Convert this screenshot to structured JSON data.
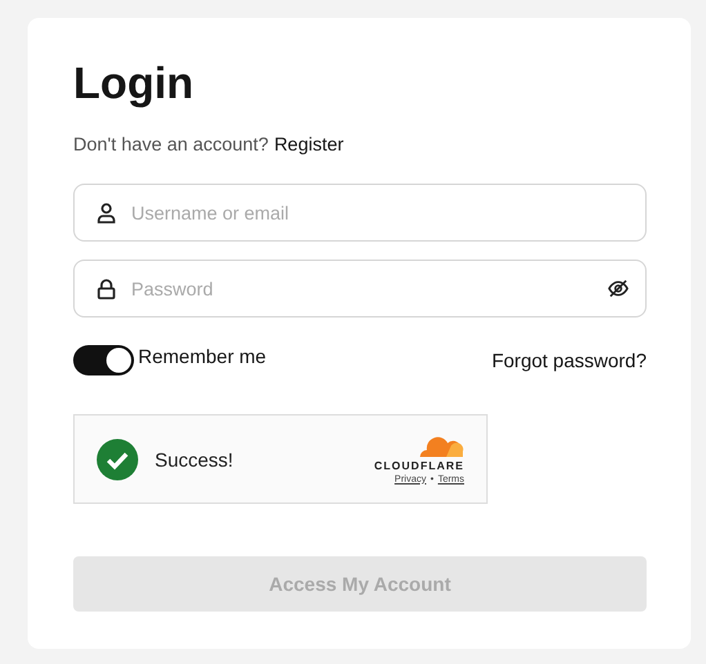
{
  "title": "Login",
  "signup": {
    "prompt": "Don't have an account?",
    "link": "Register"
  },
  "fields": [
    {
      "kind": "user",
      "placeholder": "Username or email"
    },
    {
      "kind": "password",
      "placeholder": "Password"
    }
  ],
  "remember": {
    "label": "Remember me",
    "on": true
  },
  "forgot": "Forgot password?",
  "captcha": {
    "status": "Success!",
    "success": true,
    "brand": "CLOUDFLARE",
    "links": [
      "Privacy",
      "Terms"
    ],
    "separator": "•"
  },
  "submit": {
    "label": "Access My Account",
    "disabled": true
  }
}
